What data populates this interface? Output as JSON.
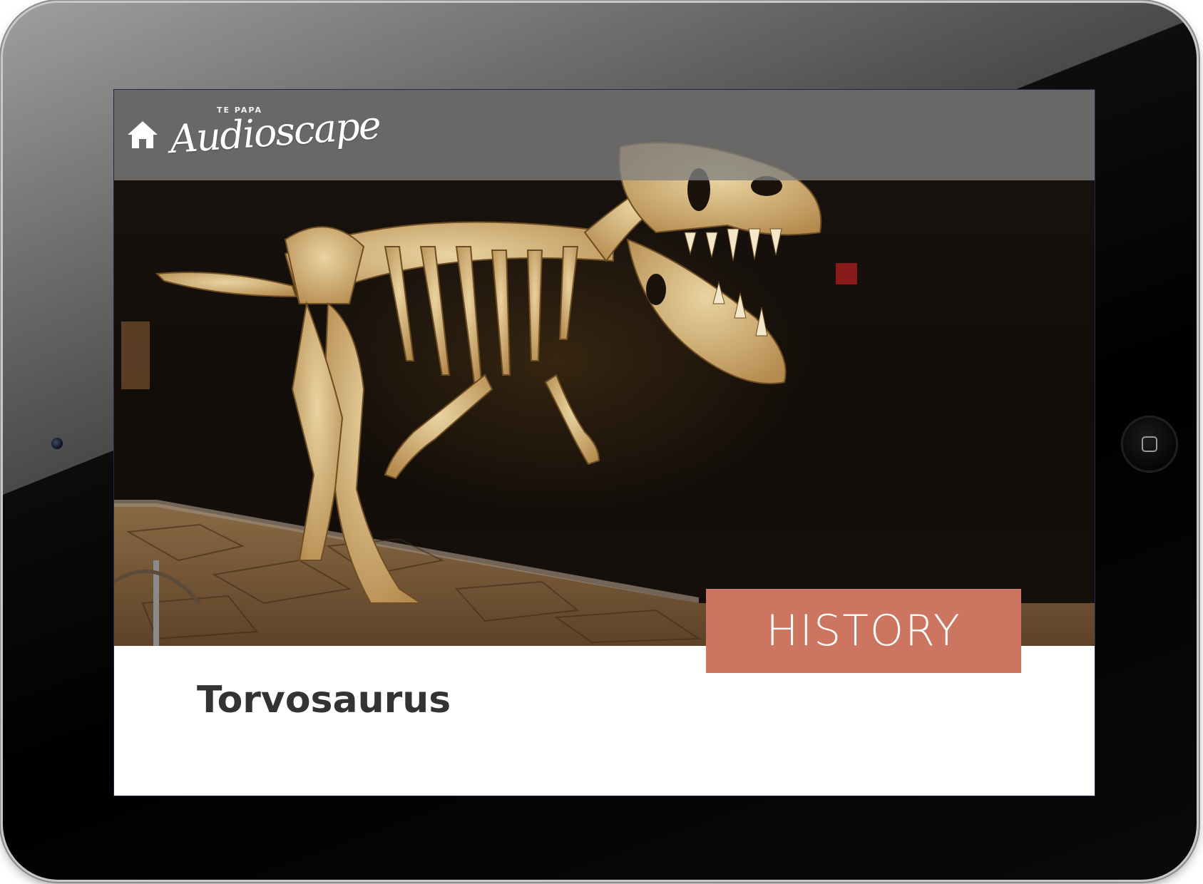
{
  "app": {
    "logo_small": "TE PAPA",
    "logo_name": "Audioscape"
  },
  "header": {
    "home_icon": "home-icon"
  },
  "hero": {
    "category_label": "HISTORY",
    "category_color": "#cc7662",
    "image_subject": "dinosaur-skeleton"
  },
  "content": {
    "title": "Torvosaurus"
  }
}
